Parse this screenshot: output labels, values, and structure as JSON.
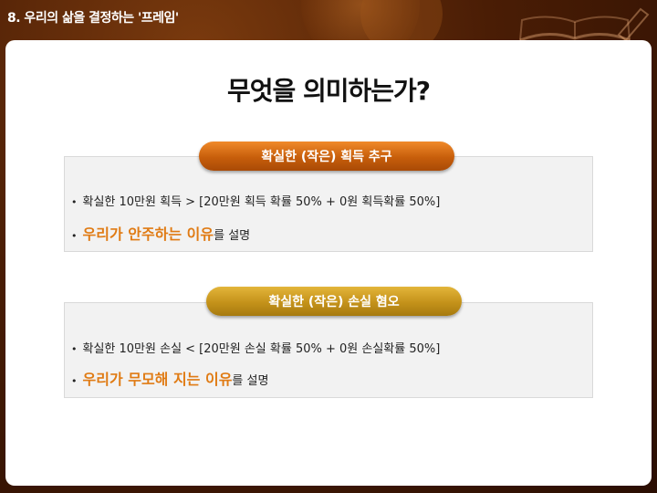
{
  "header": {
    "title": "8. 우리의 삶을 결정하는 '프레임'"
  },
  "main": {
    "heading": "무엇을 의미하는가?"
  },
  "sections": [
    {
      "pill_label": "확실한 (작은) 획득 추구",
      "bullets": [
        {
          "marker": "•",
          "text": "확실한 10만원 획득 > [20만원 획득 확률 50% + 0원 획득확률 50%]"
        },
        {
          "marker": "•",
          "highlight": "우리가 안주하는 이유",
          "rest": "를 설명"
        }
      ]
    },
    {
      "pill_label": "확실한 (작은) 손실 혐오",
      "bullets": [
        {
          "marker": "•",
          "text": "확실한 10만원 손실 <  [20만원 손실 확률 50% + 0원 손실확률 50%]"
        },
        {
          "marker": "•",
          "highlight": "우리가 무모해 지는 이유",
          "rest": "를 설명"
        }
      ]
    }
  ],
  "colors": {
    "highlight": "#e07b14",
    "pill_orange": "#c75e0b",
    "pill_gold": "#c4921a",
    "background": "#4a1d05"
  },
  "icons": [
    "open-book-icon",
    "pencil-icon"
  ]
}
